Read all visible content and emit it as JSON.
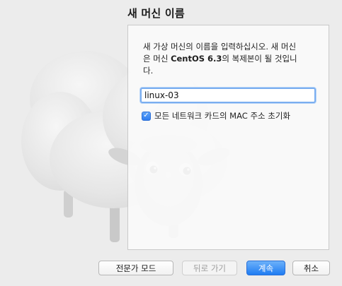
{
  "title": "새 머신 이름",
  "description": {
    "line1": "새 가상 머신의 이름을 입력하십시오. 새 머신",
    "line2_pre": "은 머신 ",
    "line2_bold": "CentOS 6.3",
    "line2_post": "의 복제본이 될 것입니",
    "line3": "다."
  },
  "name_field": {
    "value": "linux-03"
  },
  "reset_mac": {
    "checked": true,
    "label": "모든 네트워크 카드의 MAC 주소 초기화"
  },
  "buttons": {
    "expert_mode": "전문가 모드",
    "back": "뒤로 가기",
    "continue": "계속",
    "cancel": "취소"
  }
}
